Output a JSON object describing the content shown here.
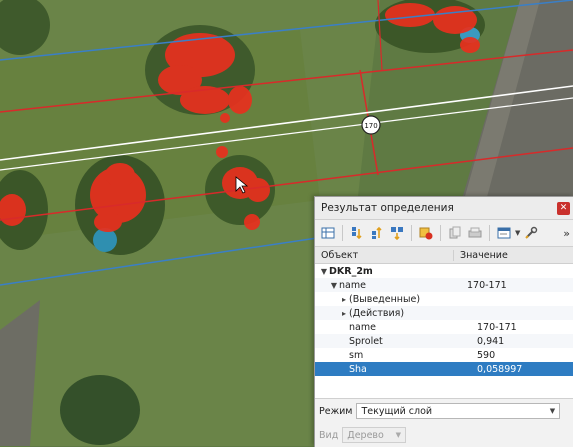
{
  "map": {
    "road_label": "170"
  },
  "panel": {
    "title": "Результат определения",
    "toolbar_icons": [
      "layer-table-icon",
      "expand-icon",
      "collapse-icon",
      "expand-all-icon",
      "clear-highlight-icon",
      "copy-icon",
      "print-icon",
      "open-form-icon",
      "settings-icon"
    ],
    "more_label": "»",
    "columns": {
      "object": "Объект",
      "value": "Значение"
    },
    "rows": [
      {
        "key": "DKR_2m",
        "value": "",
        "level": 0,
        "arrow": "▼",
        "bold": true,
        "selected": false
      },
      {
        "key": "name",
        "value": "170-171",
        "level": 1,
        "arrow": "▼",
        "bold": false,
        "selected": false
      },
      {
        "key": "(Выведенные)",
        "value": "",
        "level": 2,
        "arrow": "▸",
        "bold": false,
        "selected": false
      },
      {
        "key": "(Действия)",
        "value": "",
        "level": 2,
        "arrow": "▸",
        "bold": false,
        "selected": false
      },
      {
        "key": "name",
        "value": "170-171",
        "level": 2,
        "arrow": "",
        "bold": false,
        "selected": false
      },
      {
        "key": "Sprolet",
        "value": "0,941",
        "level": 2,
        "arrow": "",
        "bold": false,
        "selected": false
      },
      {
        "key": "sm",
        "value": "590",
        "level": 2,
        "arrow": "",
        "bold": false,
        "selected": false
      },
      {
        "key": "Sha",
        "value": "0,058997",
        "level": 2,
        "arrow": "",
        "bold": false,
        "selected": true
      }
    ],
    "mode_label": "Режим",
    "mode_value": "Текущий слой",
    "view_label": "Вид",
    "view_value": "Дерево",
    "colors": {
      "selection": "#2e7cc2",
      "close": "#c9302c"
    }
  }
}
